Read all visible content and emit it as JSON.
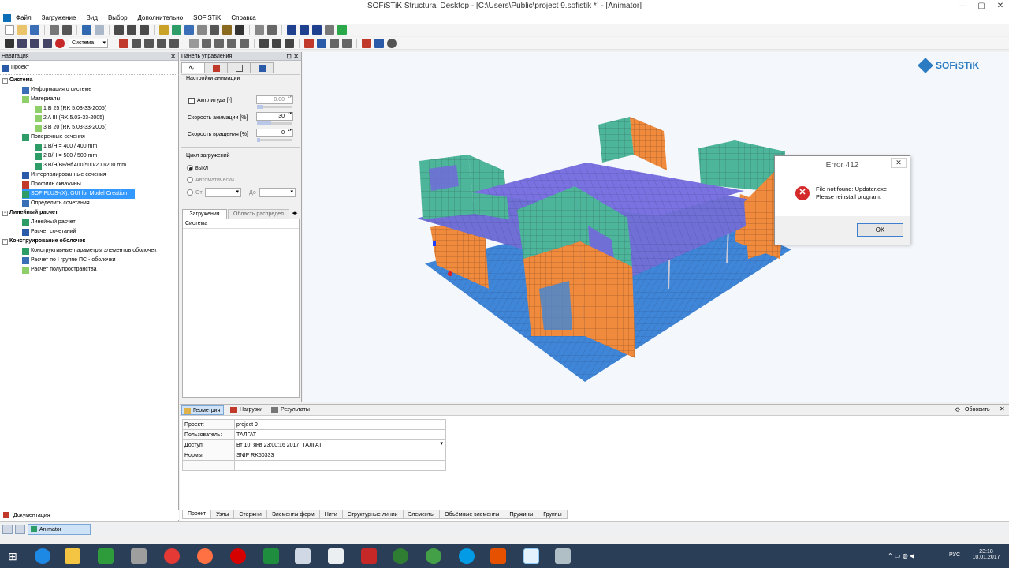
{
  "window": {
    "title": "SOFiSTiK Structural Desktop - [C:\\Users\\Public\\project 9.sofistik *] - [Animator]",
    "controls": [
      "—",
      "▢",
      "✕"
    ]
  },
  "menu": [
    "Файл",
    "Загружение",
    "Вид",
    "Выбор",
    "Дополнительно",
    "SOFiSTiK",
    "Справка"
  ],
  "toolbar": {
    "combo_system": "Система"
  },
  "navigation": {
    "header": "Навигация",
    "close": "✕",
    "root": "Проект",
    "items": [
      {
        "label": "Система",
        "level": 0,
        "bold": true
      },
      {
        "label": "Информация о системе",
        "level": 1
      },
      {
        "label": "Материалы",
        "level": 1
      },
      {
        "label": "1 B 25 (RK 5.03-33-2005)",
        "level": 2
      },
      {
        "label": "2 A III (RK 5.03-33-2005)",
        "level": 2
      },
      {
        "label": "3 B 20 (RK 5.03-33-2005)",
        "level": 2
      },
      {
        "label": "Поперечные сечения",
        "level": 1
      },
      {
        "label": "1 B/H = 400 / 400 mm",
        "level": 2
      },
      {
        "label": "2 B/H = 500 / 500 mm",
        "level": 2
      },
      {
        "label": "3 B/H/Bн/Hf 400/500/200/200 mm",
        "level": 2
      },
      {
        "label": "Интерполированные сечения",
        "level": 1
      },
      {
        "label": "Профиль скважины",
        "level": 1
      },
      {
        "label": "SOFIPLUS-(X): GUI for Model Creation",
        "level": 1,
        "selected": true
      },
      {
        "label": "Определить сочетания",
        "level": 1
      },
      {
        "label": "Линейный расчет",
        "level": 0,
        "bold": true
      },
      {
        "label": "Линейный расчет",
        "level": 1
      },
      {
        "label": "Расчет сочетаний",
        "level": 1
      },
      {
        "label": "Конструирование оболочек",
        "level": 0,
        "bold": true
      },
      {
        "label": "Конструктивные параметры элементов оболочек",
        "level": 1
      },
      {
        "label": "Расчет по I группе ПС - оболочки",
        "level": 1
      },
      {
        "label": "Расчет полупространства",
        "level": 1
      }
    ],
    "doc": "Документация"
  },
  "control_panel": {
    "header": "Панель управления",
    "section_anim": "Настройки анимации",
    "amplitude_label": "Амплитуда [-]",
    "amplitude_value": "0.00",
    "anim_speed_label": "Скорость анимации [%]",
    "anim_speed_value": "30",
    "rot_speed_label": "Скорость вращения [%]",
    "rot_speed_value": "0",
    "cycle_label": "Цикл загружений",
    "opt_off": "выкл",
    "opt_auto": "Автоматически",
    "from_label": "От",
    "to_label": "До",
    "tab_loads": "Загружения",
    "tab_area": "Область распредел",
    "list_header": "Система"
  },
  "bottom": {
    "tabs": [
      "Геометрия",
      "Нагрузки",
      "Результаты"
    ],
    "refresh": "Обновить",
    "rows": [
      {
        "key": "Проект:",
        "value": "project 9"
      },
      {
        "key": "Пользователь:",
        "value": "ТАЛГАТ"
      },
      {
        "key": "Доступ:",
        "value": "Вт 10. янв 23:00:16 2017, ТАЛГАТ"
      },
      {
        "key": "Нормы:",
        "value": "SNIP RK50333"
      }
    ],
    "subtabs": [
      "Проект",
      "Узлы",
      "Стержни",
      "Элементы ферм",
      "Нити",
      "Структурные линии",
      "Элементы",
      "Объёмные элементы",
      "Пружины",
      "Группы"
    ]
  },
  "status": {
    "animator": "Animator"
  },
  "logo": {
    "text": "SOFiSTiK",
    "color": "#2b7cc3"
  },
  "dialog": {
    "title": "Error 412",
    "line1": "File not found: Updater.exe",
    "line2": "Please reinstall program.",
    "ok": "OK",
    "close": "✕"
  },
  "taskbar": {
    "lang": "РУС",
    "time": "23:18",
    "date": "10.01.2017"
  },
  "colors": {
    "slab": "#6f6fd6",
    "wall_green": "#4cb59a",
    "wall_orange": "#f08a3c",
    "base": "#3f86d8"
  }
}
